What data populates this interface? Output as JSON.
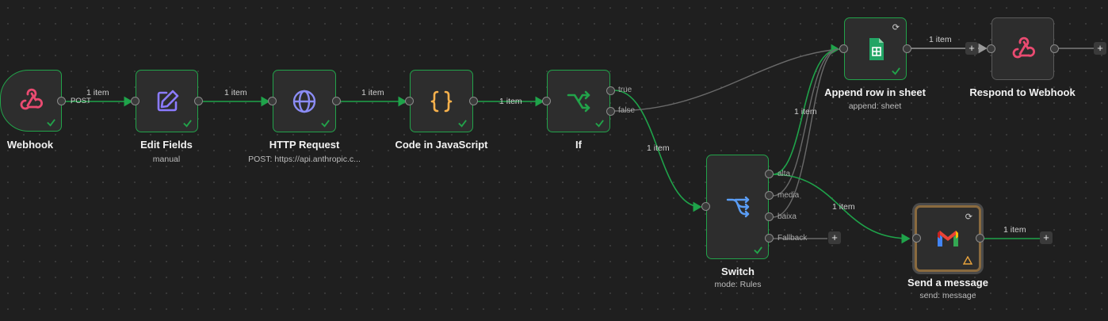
{
  "colors": {
    "success": "#22a34a",
    "edge": "#1fa34a",
    "edge_inactive": "#6a6a6a",
    "webhook": "#ea4b71",
    "edit": "#8b7bff",
    "http": "#8b8cf5",
    "code": "#f7b14c",
    "if": "#22a34a",
    "switch": "#5a9df5"
  },
  "nodes": {
    "webhook": {
      "title": "Webhook",
      "subtitle": "",
      "icon": "webhook-icon"
    },
    "edit_fields": {
      "title": "Edit Fields",
      "subtitle": "manual",
      "icon": "pencil-icon"
    },
    "http_request": {
      "title": "HTTP Request",
      "subtitle": "POST: https://api.anthropic.c...",
      "icon": "globe-icon"
    },
    "code": {
      "title": "Code in JavaScript",
      "subtitle": "",
      "icon": "code-braces-icon"
    },
    "if": {
      "title": "If",
      "subtitle": "",
      "icon": "branch-icon",
      "outputs": [
        "true",
        "false"
      ]
    },
    "switch": {
      "title": "Switch",
      "subtitle": "mode: Rules",
      "icon": "switch-icon",
      "outputs": [
        "alta",
        "media",
        "baixa",
        "Fallback"
      ]
    },
    "append_sheet": {
      "title": "Append row in sheet",
      "subtitle": "append: sheet",
      "icon": "google-sheets-icon"
    },
    "respond_webhook": {
      "title": "Respond to Webhook",
      "subtitle": "",
      "icon": "webhook-icon"
    },
    "send_message": {
      "title": "Send a message",
      "subtitle": "send: message",
      "icon": "gmail-icon"
    }
  },
  "connections": {
    "webhook_post": "POST",
    "item_count": "1 item"
  },
  "glyphs": {
    "add": "+",
    "sync": "⟳"
  }
}
